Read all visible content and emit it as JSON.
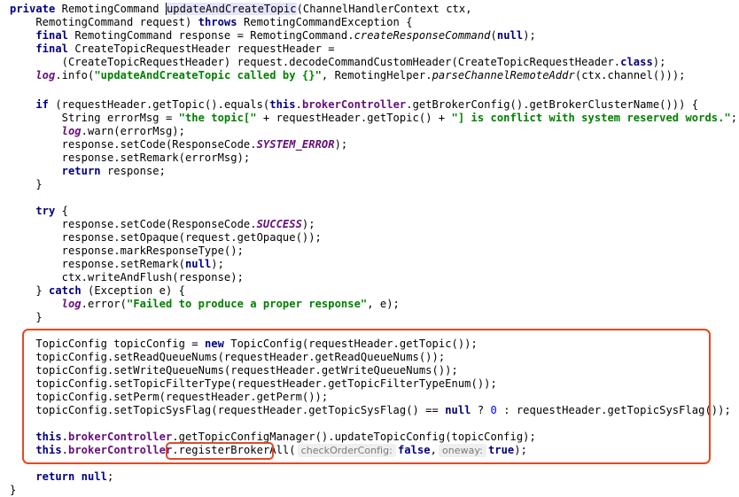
{
  "editor": {
    "language": "java",
    "method_name": "updateAndCreateTopic",
    "highlight_color": "#e04a28",
    "lines": {
      "l1": {
        "kw": "private",
        "a": " RemotingCommand ",
        "m": "updateAndCreateTopic",
        "b": "(ChannelHandlerContext ctx,"
      },
      "l2": {
        "a": "    RemotingCommand request) ",
        "kw": "throws",
        "b": " RemotingCommandException {"
      },
      "l3": {
        "kw": "    final",
        "a": " RemotingCommand response = RemotingCommand.",
        "it": "createResponseCommand",
        "b": "(",
        "kw2": "null",
        "c": ");"
      },
      "l4": {
        "kw": "    final",
        "a": " CreateTopicRequestHeader requestHeader ="
      },
      "l5": {
        "a": "        (CreateTopicRequestHeader) request.decodeCommandCustomHeader(CreateTopicRequestHeader.",
        "kw": "class",
        "b": ");"
      },
      "l6": {
        "log": "    log",
        "a": ".info(",
        "str": "\"updateAndCreateTopic called by {}\"",
        "b": ", RemotingHelper.",
        "it": "parseChannelRemoteAddr",
        "c": "(ctx.channel()));"
      },
      "l8": {
        "kw": "    if",
        "a": " (requestHeader.getTopic().equals(",
        "kw2": "this",
        "b": ".",
        "fld": "brokerController",
        "c": ".getBrokerConfig().getBrokerClusterName())) {"
      },
      "l9": {
        "a": "        String errorMsg = ",
        "str": "\"the topic[\"",
        "b": " + requestHeader.getTopic() + ",
        "str2": "\"] is conflict with system reserved words.\"",
        "c": ";"
      },
      "l10": {
        "log": "        log",
        "a": ".warn(errorMsg);"
      },
      "l11": {
        "a": "        response.setCode(ResponseCode.",
        "const": "SYSTEM_ERROR",
        "b": ");"
      },
      "l12": {
        "a": "        response.setRemark(errorMsg);"
      },
      "l13": {
        "kw": "        return",
        "a": " response;"
      },
      "l14": {
        "a": "    }"
      },
      "l16": {
        "kw": "    try",
        "a": " {"
      },
      "l17": {
        "a": "        response.setCode(ResponseCode.",
        "const": "SUCCESS",
        "b": ");"
      },
      "l18": {
        "a": "        response.setOpaque(request.getOpaque());"
      },
      "l19": {
        "a": "        response.markResponseType();"
      },
      "l20": {
        "a": "        response.setRemark(",
        "kw": "null",
        "b": ");"
      },
      "l21": {
        "a": "        ctx.writeAndFlush(response);"
      },
      "l22": {
        "a": "    } ",
        "kw": "catch",
        "b": " (Exception e) {"
      },
      "l23": {
        "log": "        log",
        "a": ".error(",
        "str": "\"Failed to produce a proper response\"",
        "b": ", e);"
      },
      "l24": {
        "a": "    }"
      },
      "l26": {
        "a": "    TopicConfig topicConfig = ",
        "kw": "new",
        "b": " TopicConfig(requestHeader.getTopic());"
      },
      "l27": {
        "a": "    topicConfig.setReadQueueNums(requestHeader.getReadQueueNums());"
      },
      "l28": {
        "a": "    topicConfig.setWriteQueueNums(requestHeader.getWriteQueueNums());"
      },
      "l29": {
        "a": "    topicConfig.setTopicFilterType(requestHeader.getTopicFilterTypeEnum());"
      },
      "l30": {
        "a": "    topicConfig.setPerm(requestHeader.getPerm());"
      },
      "l31": {
        "a": "    topicConfig.setTopicSysFlag(requestHeader.getTopicSysFlag() == ",
        "kw": "null",
        "b": " ? ",
        "num": "0",
        "c": " : requestHeader.getTopicSysFlag());"
      },
      "l33": {
        "kw": "    this",
        "a": ".",
        "fld": "brokerController",
        "b": ".getTopicConfigManager().updateTopicConfig(topicConfig);"
      },
      "l34": {
        "kw": "    this",
        "a": ".",
        "fld": "brokerController",
        "b": ".",
        "m": "registerBrokerAll",
        "c": "(",
        "hint1": "checkOrderConfig:",
        "kw2": "false",
        "d": ",",
        "hint2": "oneway:",
        "kw3": "true",
        "e": ");"
      },
      "l36": {
        "kw": "    return",
        "a": " ",
        "kw2": "null",
        "b": ";"
      },
      "l37": {
        "a": "}"
      }
    }
  }
}
